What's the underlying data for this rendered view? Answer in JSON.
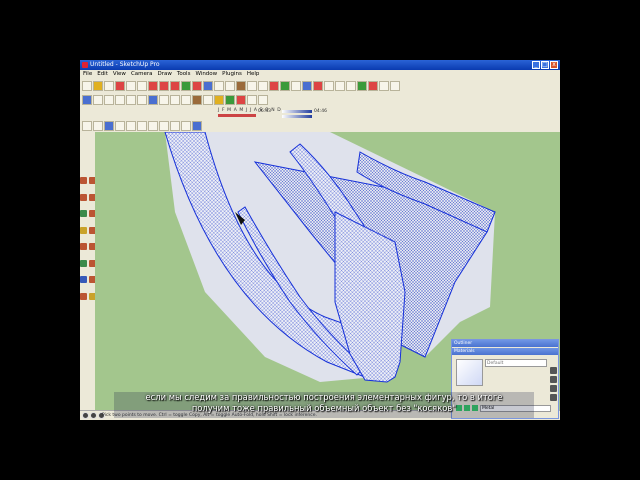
{
  "window": {
    "title": "Untitled - SketchUp Pro",
    "controls": {
      "minimize": "_",
      "maximize": "□",
      "close": "x"
    }
  },
  "menu": [
    "File",
    "Edit",
    "View",
    "Camera",
    "Draw",
    "Tools",
    "Window",
    "Plugins",
    "Help"
  ],
  "shadows": {
    "months": "J F M A M J J A S O N D",
    "time_left": "06:43",
    "time_mid": "Noon",
    "time_right": "04:46"
  },
  "status_bar": {
    "text": "Pick two points to move.  Ctrl = toggle Copy, Alt = toggle Auto-Fold, hold Shift = lock inference."
  },
  "materials_panel": {
    "outliner_title": "Outliner",
    "materials_title": "Materials",
    "material_name": "Default",
    "library": "Metal"
  },
  "subtitle": {
    "line1": "если мы следим за правильностью построения элементарных фигур, то в итоге",
    "line2": "получим тоже правильный объемный объект без \"косяков\""
  },
  "colors": {
    "title_bar": "#0a3bb0",
    "sky": "#ffffff",
    "ground": "#a3c68d",
    "edges": "#1530d9",
    "faces": "#eeeeee"
  }
}
